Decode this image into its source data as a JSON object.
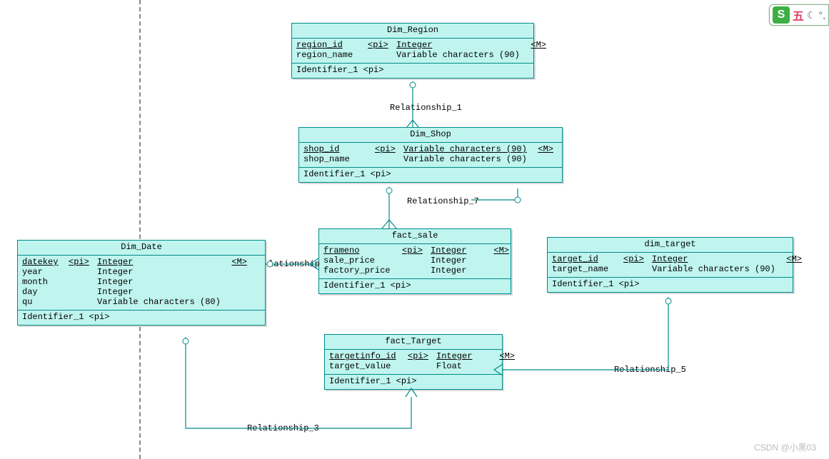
{
  "entities": {
    "dim_region": {
      "title": "Dim_Region",
      "rows": [
        {
          "name": "region_id",
          "pi": "<pi>",
          "type": "Integer",
          "m": "<M>",
          "pk": true
        },
        {
          "name": "region_name",
          "pi": "",
          "type": "Variable characters (90)",
          "m": ""
        }
      ],
      "identifier": "Identifier_1 <pi>"
    },
    "dim_shop": {
      "title": "Dim_Shop",
      "rows": [
        {
          "name": "shop_id",
          "pi": "<pi>",
          "type": "Variable characters (90)",
          "m": "<M>",
          "pk": true
        },
        {
          "name": "shop_name",
          "pi": "",
          "type": "Variable characters (90)",
          "m": ""
        }
      ],
      "identifier": "Identifier_1 <pi>"
    },
    "fact_sale": {
      "title": "fact_sale",
      "rows": [
        {
          "name": "frameno",
          "pi": "<pi>",
          "type": "Integer",
          "m": "<M>",
          "pk": true
        },
        {
          "name": "sale_price",
          "pi": "",
          "type": "Integer",
          "m": ""
        },
        {
          "name": "factory_price",
          "pi": "",
          "type": "Integer",
          "m": ""
        }
      ],
      "identifier": "Identifier_1 <pi>"
    },
    "dim_date": {
      "title": "Dim_Date",
      "rows": [
        {
          "name": "datekey",
          "pi": "<pi>",
          "type": "Integer",
          "m": "<M>",
          "pk": true
        },
        {
          "name": "year",
          "pi": "",
          "type": "Integer",
          "m": ""
        },
        {
          "name": "month",
          "pi": "",
          "type": "Integer",
          "m": ""
        },
        {
          "name": "day",
          "pi": "",
          "type": "Integer",
          "m": ""
        },
        {
          "name": "qu",
          "pi": "",
          "type": "Variable characters (80)",
          "m": ""
        }
      ],
      "identifier": "Identifier_1 <pi>"
    },
    "dim_target": {
      "title": "dim_target",
      "rows": [
        {
          "name": "target_id",
          "pi": "<pi>",
          "type": "Integer",
          "m": "<M>",
          "pk": true
        },
        {
          "name": "target_name",
          "pi": "",
          "type": "Variable characters (90)",
          "m": ""
        }
      ],
      "identifier": "Identifier_1 <pi>"
    },
    "fact_target": {
      "title": "fact_Target",
      "rows": [
        {
          "name": "targetinfo_id",
          "pi": "<pi>",
          "type": "Integer",
          "m": "<M>",
          "pk": true
        },
        {
          "name": "target_value",
          "pi": "",
          "type": "Float",
          "m": ""
        }
      ],
      "identifier": "Identifier_1 <pi>"
    }
  },
  "relationships": {
    "r1": "Relationship_1",
    "r7": "Relationship_7",
    "r_date_sale": "lationship",
    "r5": "Relationship_5",
    "r3": "Relationship_3"
  },
  "watermark": "CSDN @小黑03",
  "ime": {
    "logo": "S",
    "text": "五",
    "moon": "☾",
    "dot": "°,"
  }
}
